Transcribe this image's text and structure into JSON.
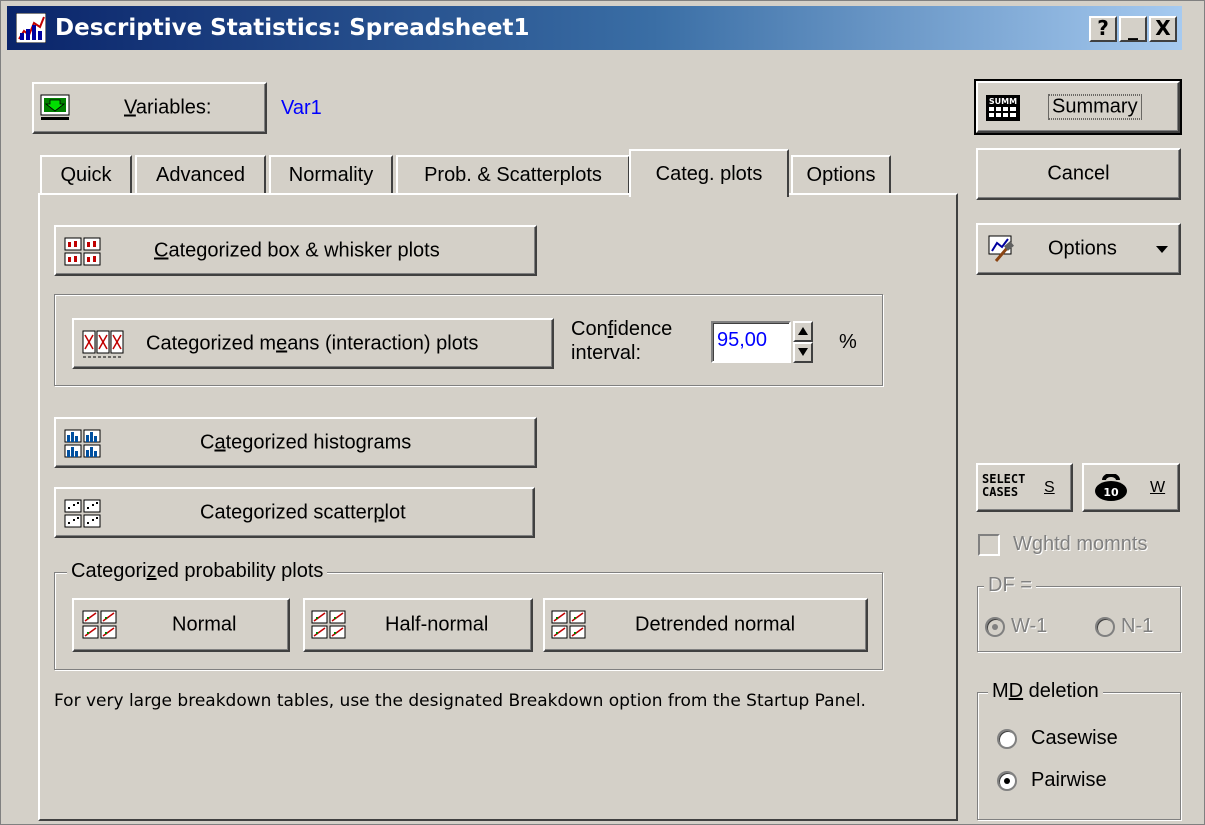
{
  "window": {
    "title": "Descriptive Statistics: Spreadsheet1",
    "help_btn": "?",
    "min_btn": "_",
    "close_btn": "X"
  },
  "variables": {
    "button_label_u": "V",
    "button_label_rest": "ariables:",
    "value": "Var1"
  },
  "tabs": [
    {
      "label": "Quick"
    },
    {
      "label": "Advanced"
    },
    {
      "label": "Normality"
    },
    {
      "label": "Prob. & Scatterplots"
    },
    {
      "label": "Categ. plots",
      "active": true
    },
    {
      "label": "Options"
    }
  ],
  "categ": {
    "box_u": "C",
    "box_rest": "ategorized box & whisker plots",
    "means_pre": "Categorized m",
    "means_u": "e",
    "means_post": "ans (interaction) plots",
    "conf_pre": "Con",
    "conf_u": "f",
    "conf_post": "idence",
    "conf_line2": "interval:",
    "conf_value": "95,00",
    "pct": "%",
    "hist_pre": "C",
    "hist_u": "a",
    "hist_post": "tegorized histograms",
    "scatter_pre": "Categorized scatter",
    "scatter_u": "p",
    "scatter_post": "lot",
    "prob_group_pre": "Categori",
    "prob_group_u": "z",
    "prob_group_post": "ed probability plots",
    "normal": "Normal",
    "half_normal": "Half-normal",
    "detrended": "Detrended  normal",
    "note": "For very large breakdown tables, use the designated Breakdown option from the Startup Panel."
  },
  "side": {
    "summary": "Summary",
    "summary_icon_text": "SUMM",
    "cancel": "Cancel",
    "options": "Options",
    "select_cases_line1": "SELECT",
    "select_cases_line2": "CASES",
    "select_key": "S",
    "weight_key": "W",
    "weight_icon_text": "10",
    "wghtd": "Wghtd momnts",
    "df_label": "DF =",
    "w1": "W-1",
    "n1": "N-1",
    "md_pre": "M",
    "md_u": "D",
    "md_post": " deletion",
    "casewise": "Casewise",
    "pairwise": "Pairwise"
  },
  "colors": {
    "face": "#d4d0c8",
    "title_start": "#0a246a",
    "title_end": "#a6caf0",
    "value_blue": "#0000ff"
  }
}
